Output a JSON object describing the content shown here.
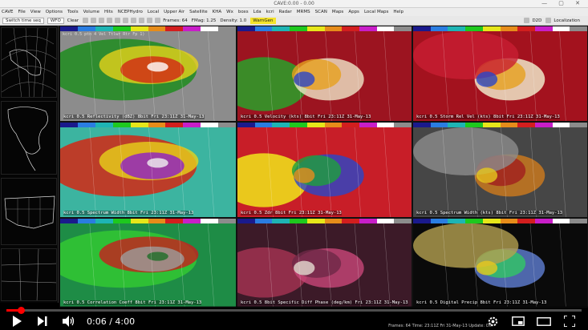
{
  "window": {
    "title": "CAVE:0.00 - 0.00",
    "controls": "— ▢ ✕"
  },
  "menu": [
    "CAVE",
    "File",
    "View",
    "Options",
    "Tools",
    "Volume",
    "Hits",
    "NCEPHydro",
    "Local",
    "Upper Air",
    "Satellite",
    "KHA",
    "Wx",
    "boxs",
    "Lda",
    "kcri",
    "Radar",
    "MRMS",
    "SCAN",
    "Maps",
    "Apps",
    "Local Maps",
    "Help"
  ],
  "toolbar": {
    "editor_select": "Switch time seq",
    "scale_select": "WFO",
    "clear_label": "Clear",
    "frames_label": "Frames: 64",
    "fmag_label": "FMag: 1.25",
    "density_label": "Density: 1.0",
    "warngen_label": "WarnGen",
    "perspective_label": "D2D",
    "localization_label": "Localization"
  },
  "panels": [
    {
      "title": "kcri 0.5 ptn 4 Vel Ttlwr Rtr Fp 1)",
      "caption": "kcri 0.5 Reflectivity (dBZ) 8bit Fri 23:11Z 31-May-13",
      "bg": "#8c8c8c",
      "blobs": [
        "#1e8c1e",
        "#e6d21a",
        "#d22814",
        "#ffffff"
      ]
    },
    {
      "title": "",
      "caption": "kcri 0.5 Velocity (kts) 8bit Fri 23:11Z 31-May-13",
      "bg": "#9c1420",
      "blobs": [
        "#2aa02a",
        "#f0e6c8",
        "#e6a01e",
        "#2a46c8"
      ]
    },
    {
      "title": "",
      "caption": "kcri 0.5 Storm Rel Vel (kts) 8bit Fri 23:11Z 31-May-13",
      "bg": "#a3121e",
      "blobs": [
        "#f0e6c8",
        "#e6a01e",
        "#c81e32",
        "#2a46c8"
      ]
    },
    {
      "title": "",
      "caption": "kcri 0.5 Spectrum Width 8bit Fri 23:11Z 31-May-13",
      "bg": "#3cb4a0",
      "blobs": [
        "#d22814",
        "#e6d21a",
        "#8c1ec8",
        "#f0f0f0"
      ]
    },
    {
      "title": "",
      "caption": "kcri 0.5 Zdr 8bit Fri 23:11Z 31-May-13",
      "bg": "#c81e28",
      "blobs": [
        "#f0e61a",
        "#2a46c8",
        "#1ea03c",
        "#e68c1e"
      ]
    },
    {
      "title": "",
      "caption": "kcri 0.5 Spectrum Width (kts) 8bit Fri 23:11Z 31-May-13",
      "bg": "#464646",
      "blobs": [
        "#c8781e",
        "#a01e1e",
        "#8c8c8c",
        "#e6c81e"
      ]
    },
    {
      "title": "",
      "caption": "kcri 0.5 Correlation Coeff 8bit Fri 23:11Z 31-May-13",
      "bg": "#1e8c46",
      "blobs": [
        "#32c832",
        "#c81e1e",
        "#9c9c9c",
        "#1e6e28"
      ]
    },
    {
      "title": "",
      "caption": "kcri 0.5 8bit Specific Diff Phase (deg/km) Fri 23:11Z 31-May-13",
      "bg": "#3c1a28",
      "blobs": [
        "#a03250",
        "#c84678",
        "#6e2846",
        "#e6dcd2"
      ]
    },
    {
      "title": "",
      "caption": "kcri 0.5 Digital Precip 8bit Fri 23:11Z 31-May-13",
      "bg": "#0a0a0a",
      "blobs": [
        "#5a78c8",
        "#32c864",
        "#b4a050",
        "#e6c81e"
      ]
    }
  ],
  "player": {
    "current_time": "0:06",
    "duration": "4:00",
    "progress_fraction": 0.025
  },
  "status": "Frames: 64 Time: 23:11Z Fri 31-May-13 Update: Off"
}
